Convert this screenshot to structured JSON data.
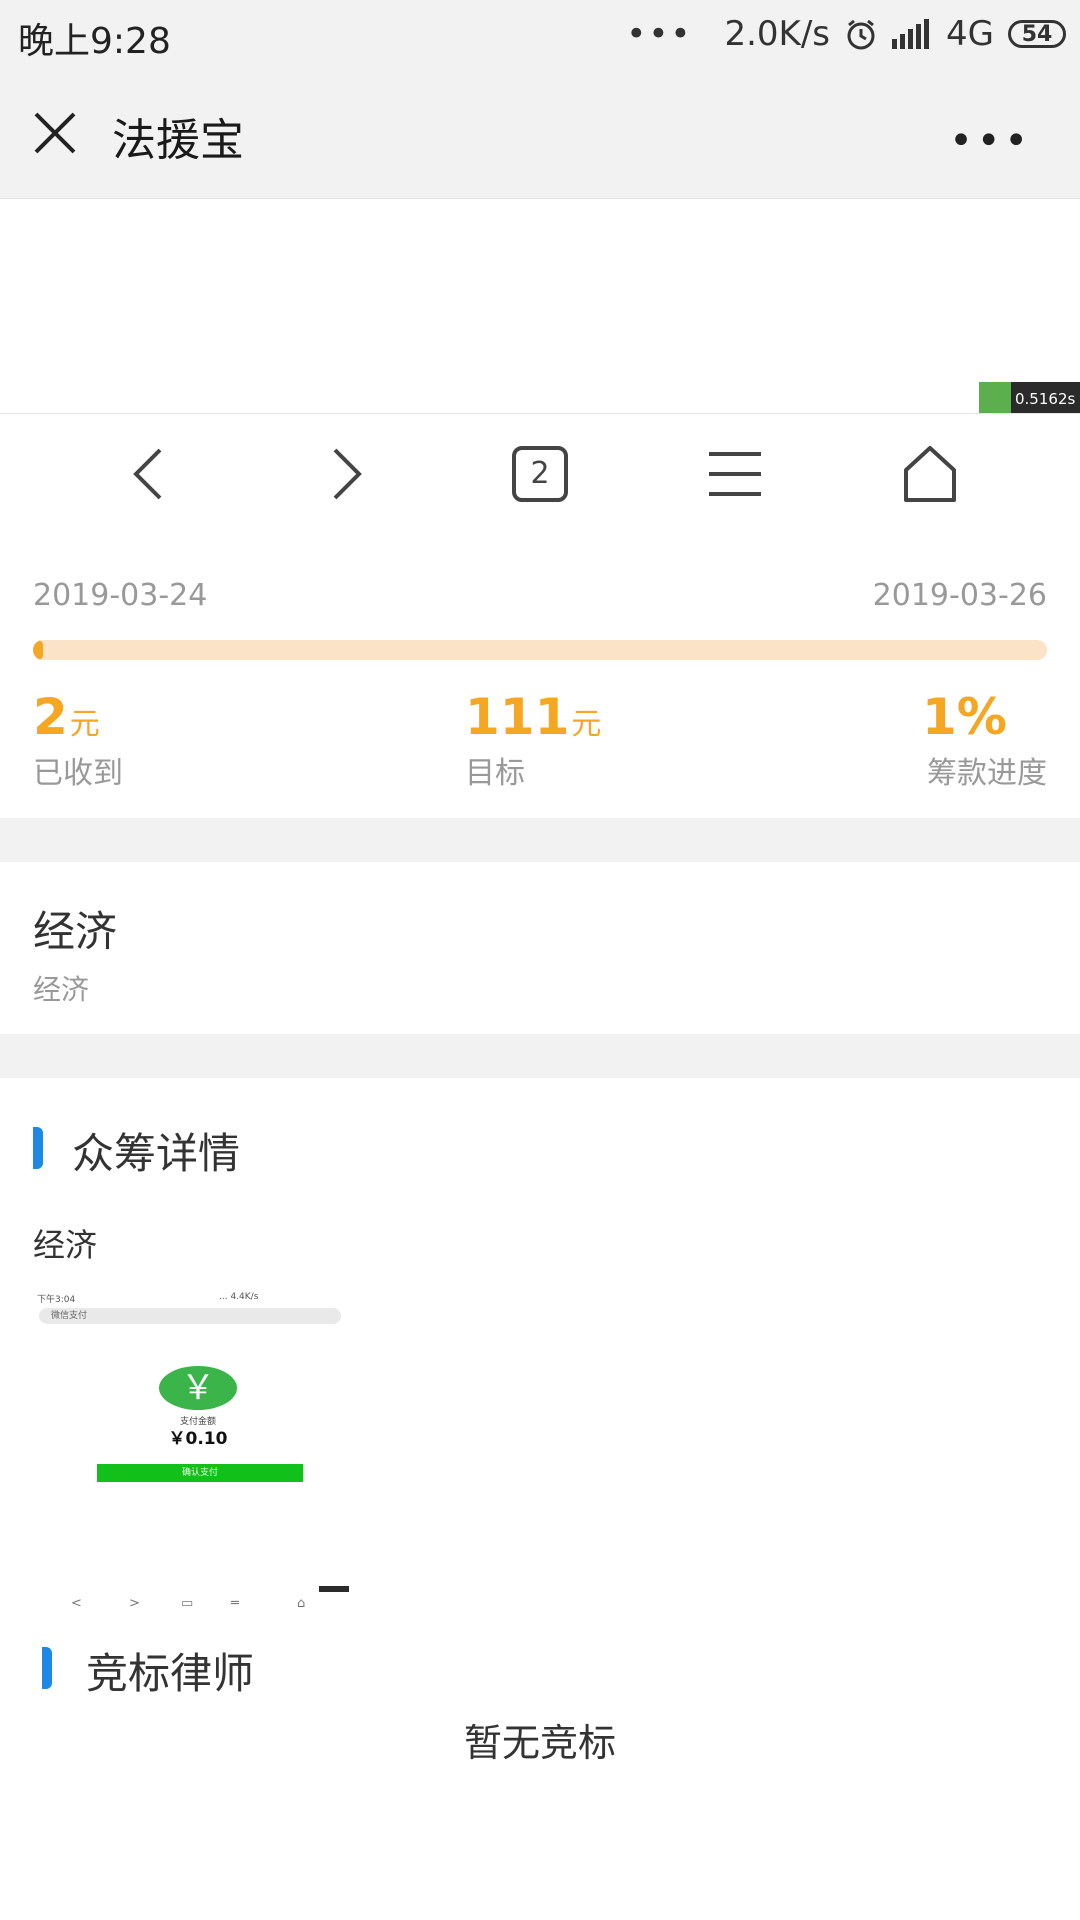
{
  "status_bar": {
    "time": "晚上9:28",
    "dots": "•••",
    "speed": "2.0K/s",
    "network": "4G",
    "battery": "54"
  },
  "header": {
    "title": "法援宝",
    "close_icon": "close-icon",
    "more": "•••"
  },
  "speed_badge": "0.5162s",
  "nav": {
    "tab_count": "2",
    "icons": [
      "back-icon",
      "forward-icon",
      "tabs-icon",
      "menu-icon",
      "home-icon"
    ]
  },
  "campaign": {
    "start_date": "2019-03-24",
    "end_date": "2019-03-26",
    "progress_percent": 1,
    "received_value": "2",
    "received_unit": "元",
    "received_label": "已收到",
    "target_value": "111",
    "target_unit": "元",
    "target_label": "目标",
    "progress_value": "1%",
    "progress_label": "筹款进度",
    "accent_color": "#f5a623"
  },
  "category": {
    "title": "经济",
    "subtitle": "经济"
  },
  "details": {
    "heading": "众筹详情",
    "text": "经济",
    "thumbnail": {
      "time": "下午3:04",
      "status": "... 4.4K/s",
      "bar_text": "微信支付",
      "currency_symbol": "￥",
      "amount_label": "支付金额",
      "amount": "￥0.10",
      "button": "确认支付"
    }
  },
  "bidding": {
    "heading": "竞标律师",
    "empty_text": "暂无竞标"
  },
  "colors": {
    "accent_blue": "#1e88e5",
    "progress_track": "#fae3c6"
  }
}
